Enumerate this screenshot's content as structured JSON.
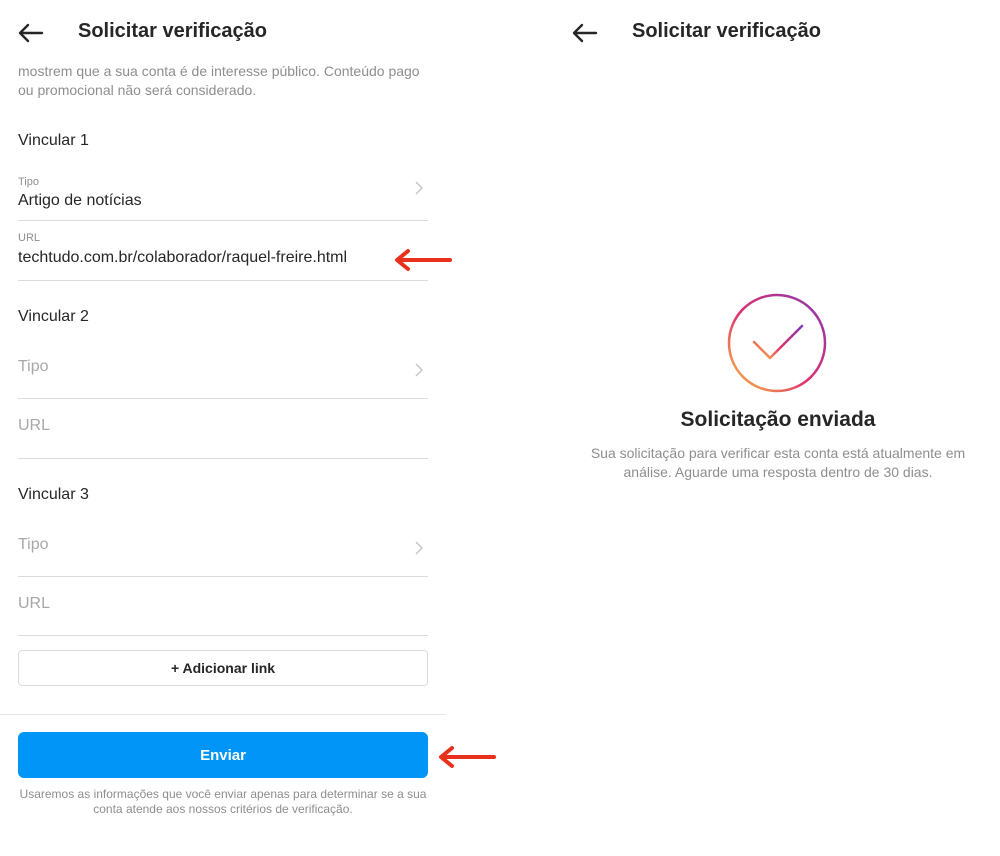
{
  "left": {
    "header": {
      "title": "Solicitar verificação"
    },
    "intro_text": "mostrem que a sua conta é de interesse público. Conteúdo pago ou promocional não será considerado.",
    "links": [
      {
        "heading": "Vincular 1",
        "type_label": "Tipo",
        "type_value": "Artigo de notícias",
        "url_label": "URL",
        "url_value": "techtudo.com.br/colaborador/raquel-freire.html"
      },
      {
        "heading": "Vincular 2",
        "type_placeholder": "Tipo",
        "url_placeholder": "URL"
      },
      {
        "heading": "Vincular 3",
        "type_placeholder": "Tipo",
        "url_placeholder": "URL"
      }
    ],
    "add_link_label": "+ Adicionar link",
    "submit_label": "Enviar",
    "footnote": "Usaremos as informações que você enviar apenas para determinar se a sua conta atende aos nossos critérios de verificação."
  },
  "right": {
    "header": {
      "title": "Solicitar verificação"
    },
    "status_title": "Solicitação enviada",
    "status_message": "Sua solicitação para verificar esta conta está atualmente em análise. Aguarde uma resposta dentro de 30 dias."
  },
  "colors": {
    "primary_button": "#0095f6",
    "annotation_arrow": "#e8301c",
    "text_dark": "#262626",
    "text_muted": "#8e8e8e"
  },
  "icons": {
    "back": "arrow-left-icon",
    "chevron": "chevron-right-icon",
    "success": "check-circle-icon",
    "annotation": "red-arrow-annotation"
  }
}
